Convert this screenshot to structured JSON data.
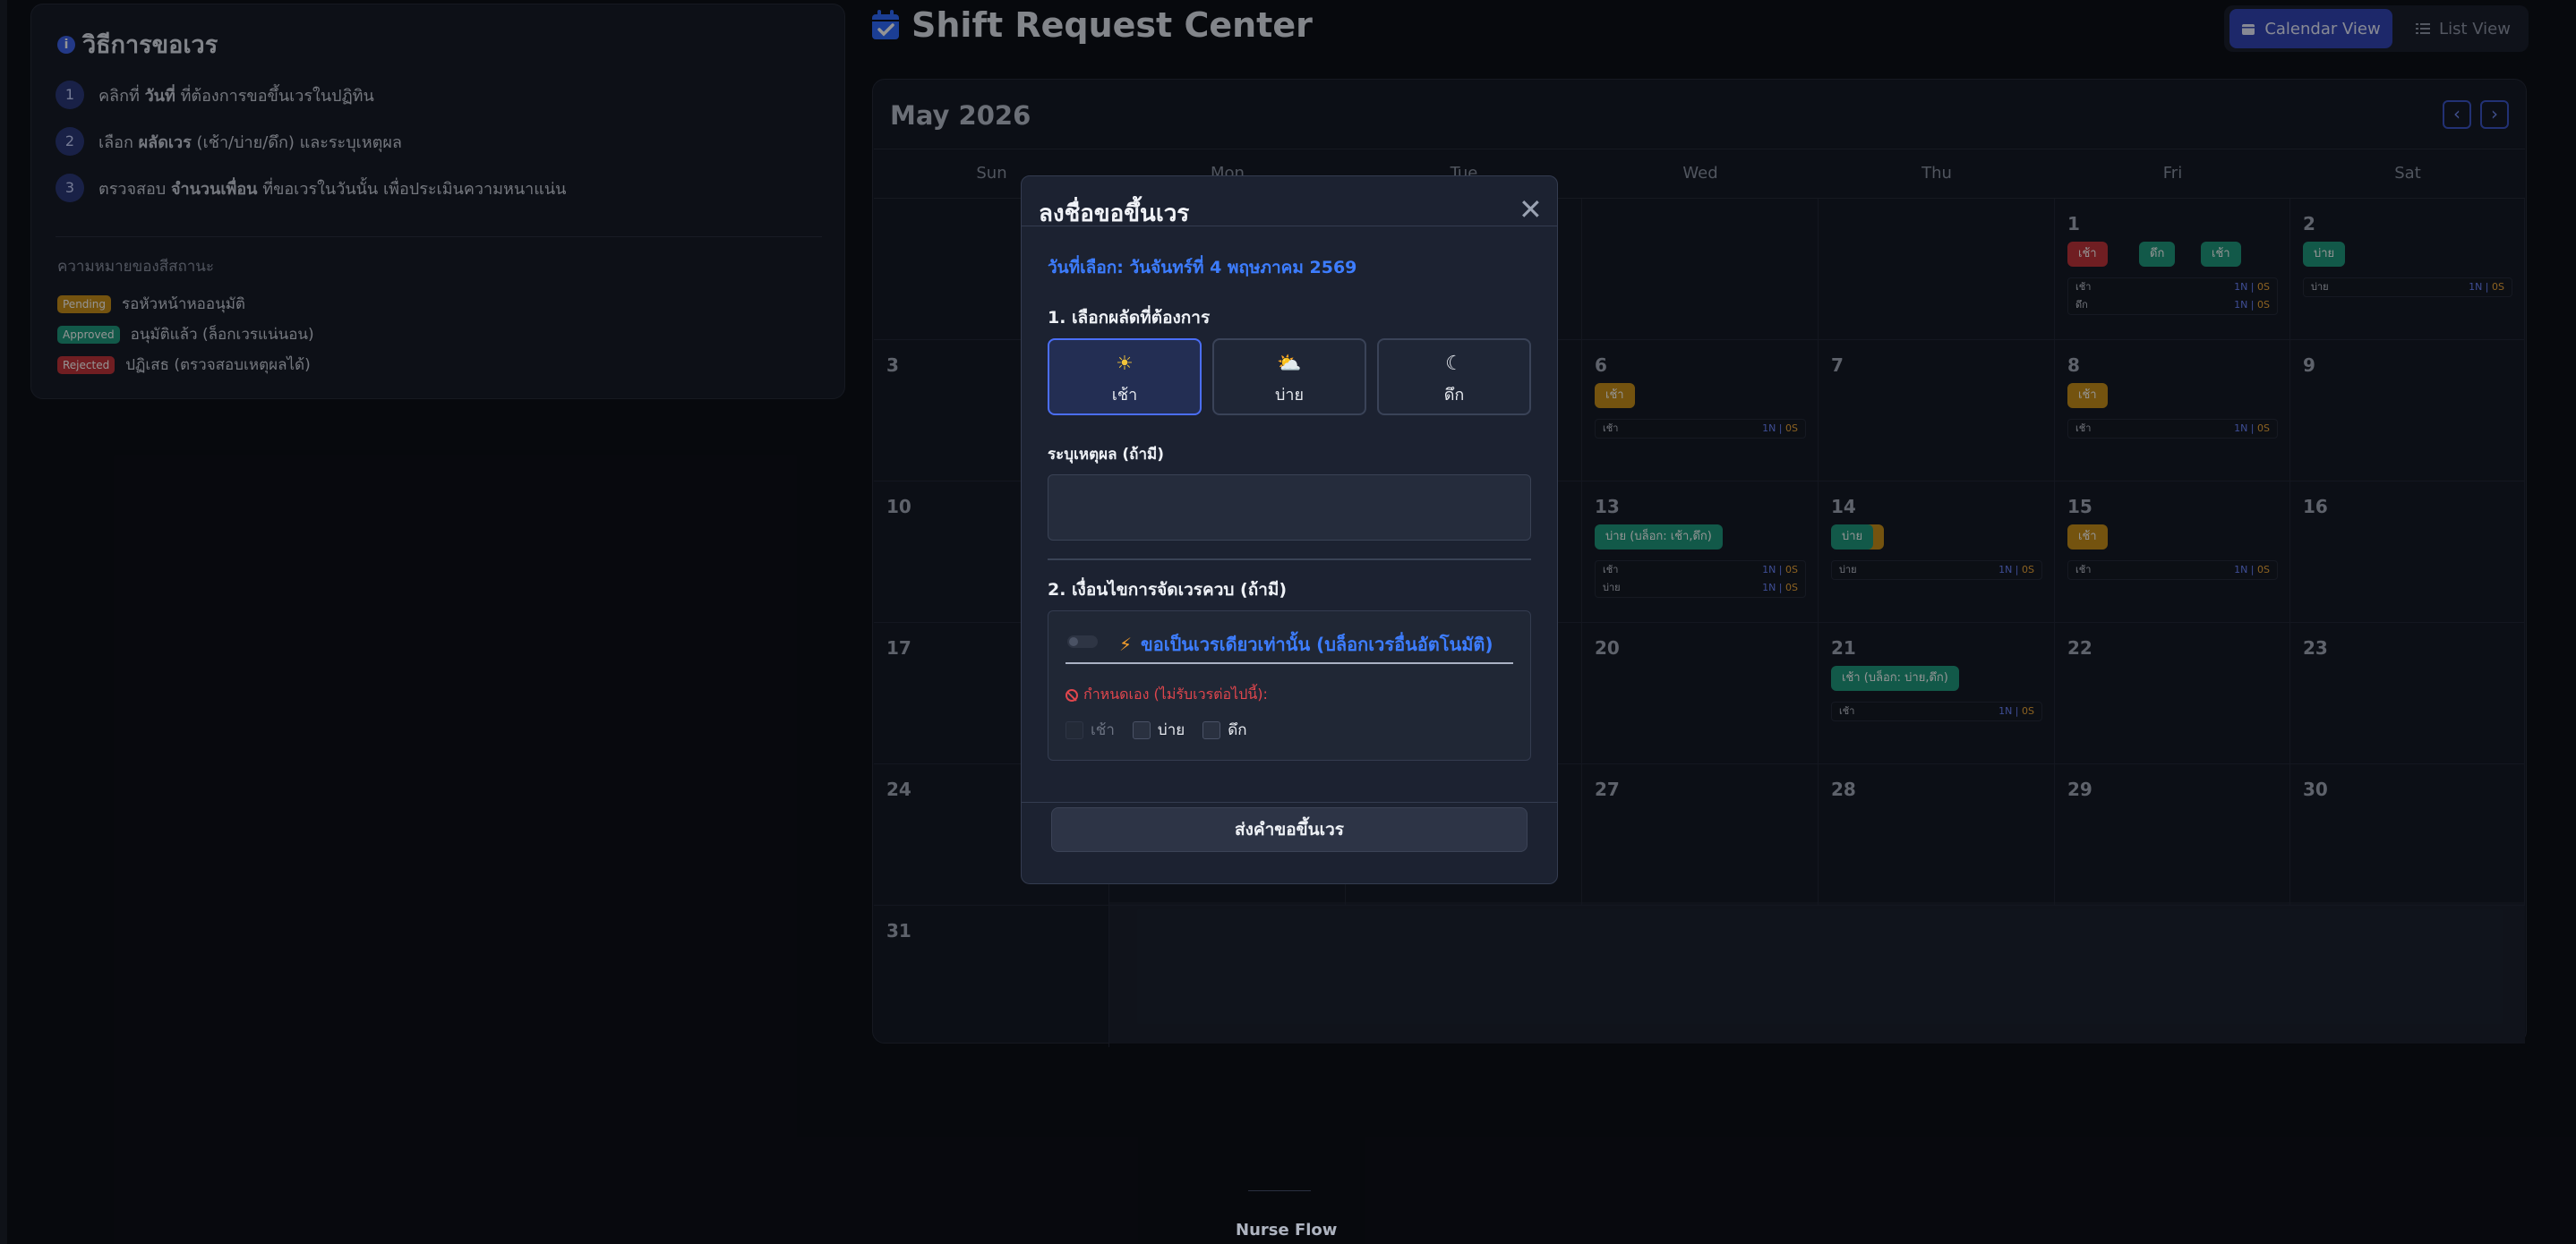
{
  "help": {
    "title": "วิธีการขอเวร",
    "steps": [
      {
        "num": "1",
        "pre": "คลิกที่ ",
        "bold": "วันที่",
        "post": " ที่ต้องการขอขึ้นเวรในปฏิทิน"
      },
      {
        "num": "2",
        "pre": "เลือก ",
        "bold": "ผลัดเวร",
        "post": " (เช้า/บ่าย/ดึก) และระบุเหตุผล"
      },
      {
        "num": "3",
        "pre": "ตรวจสอบ ",
        "bold": "จำนวนเพื่อน",
        "post": " ที่ขอเวรในวันนั้น เพื่อประเมินความหนาแน่น"
      }
    ],
    "legend_title": "ความหมายของสีสถานะ",
    "legend": [
      {
        "badge": "Pending",
        "text": "รอหัวหน้าหออนุมัติ",
        "color": "#c8901a"
      },
      {
        "badge": "Approved",
        "text": "อนุมัติแล้ว (ล็อกเวรแน่นอน)",
        "color": "#1f9a7e"
      },
      {
        "badge": "Rejected",
        "text": "ปฏิเสธ (ตรวจสอบเหตุผลได้)",
        "color": "#c2343b"
      }
    ]
  },
  "header": {
    "title": "Shift Request Center",
    "calendar_view": "Calendar View",
    "list_view": "List View"
  },
  "calendar": {
    "month": "May 2026",
    "prev_icon": "‹",
    "next_icon": "›",
    "days": [
      "Sun",
      "Mon",
      "Tue",
      "Wed",
      "Thu",
      "Fri",
      "Sat"
    ]
  },
  "modal": {
    "title": "ลงชื่อขอขึ้นเวร",
    "selected_date": "วันที่เลือก: วันจันทร์ที่ 4 พฤษภาคม 2569",
    "section1": "1. เลือกผลัดที่ต้องการ",
    "shifts": [
      {
        "label": "เช้า",
        "icon": "☀",
        "icon_name": "sun-icon"
      },
      {
        "label": "บ่าย",
        "icon": "⛅",
        "icon_name": "cloud-sun-icon"
      },
      {
        "label": "ดึก",
        "icon": "☾",
        "icon_name": "moon-icon"
      }
    ],
    "reason_label": "ระบุเหตุผล (ถ้ามี)",
    "reason_value": "",
    "section2": "2. เงื่อนไขการจัดเวรควบ (ถ้ามี)",
    "exclusive_label": "ขอเป็นเวรเดียวเท่านั้น (บล็อกเวรอื่นอัตโนมัติ)",
    "block_label": "กำหนดเอง (ไม่รับเวรต่อไปนี้):",
    "block_options": [
      "เช้า",
      "บ่าย",
      "ดึก"
    ],
    "submit": "ส่งคำขอขึ้นเวร",
    "close_icon": "✕"
  },
  "footer": "Nurse Flow"
}
